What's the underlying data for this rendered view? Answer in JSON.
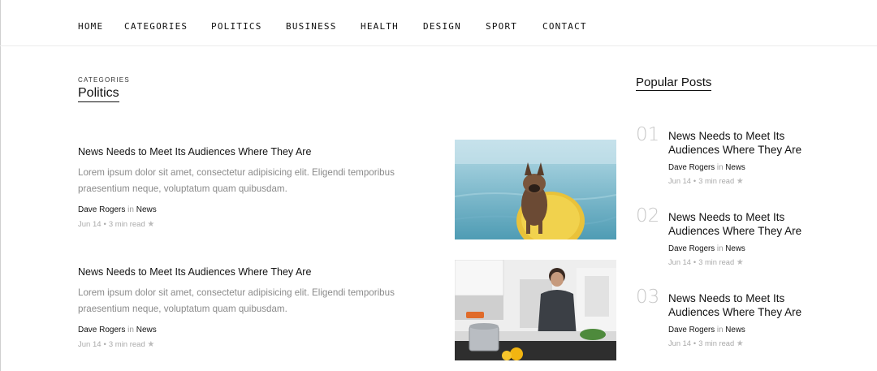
{
  "nav": {
    "items": [
      "HOME",
      "CATEGORIES",
      "POLITICS",
      "BUSINESS",
      "HEALTH",
      "DESIGN",
      "SPORT",
      "CONTACT"
    ]
  },
  "category": {
    "kicker": "CATEGORIES",
    "title": "Politics"
  },
  "posts": [
    {
      "title": "News Needs to Meet Its Audiences Where They Are",
      "excerpt": "Lorem ipsum dolor sit amet, consectetur adipisicing elit. Eligendi temporibus praesentium neque, voluptatum quam quibusdam.",
      "author": "Dave Rogers",
      "in": "in",
      "category": "News",
      "date": "Jun 14",
      "read": "3 min read",
      "image": "dog-on-paddleboard"
    },
    {
      "title": "News Needs to Meet Its Audiences Where They Are",
      "excerpt": "Lorem ipsum dolor sit amet, consectetur adipisicing elit. Eligendi temporibus praesentium neque, voluptatum quam quibusdam.",
      "author": "Dave Rogers",
      "in": "in",
      "category": "News",
      "date": "Jun 14",
      "read": "3 min read",
      "image": "man-cooking-in-kitchen"
    }
  ],
  "popular": {
    "heading": "Popular Posts",
    "items": [
      {
        "num": "01",
        "title": "News Needs to Meet Its Audiences Where They Are",
        "author": "Dave Rogers",
        "in": "in",
        "category": "News",
        "date": "Jun 14",
        "read": "3 min read"
      },
      {
        "num": "02",
        "title": "News Needs to Meet Its Audiences Where They Are",
        "author": "Dave Rogers",
        "in": "in",
        "category": "News",
        "date": "Jun 14",
        "read": "3 min read"
      },
      {
        "num": "03",
        "title": "News Needs to Meet Its Audiences Where They Are",
        "author": "Dave Rogers",
        "in": "in",
        "category": "News",
        "date": "Jun 14",
        "read": "3 min read"
      }
    ]
  },
  "icons": {
    "rating": "star-icon",
    "separator": "dot-separator"
  },
  "colors": {
    "text": "#111111",
    "muted": "#8a8a8a",
    "meta": "#aaaaaa",
    "number": "#c9c9c9"
  }
}
